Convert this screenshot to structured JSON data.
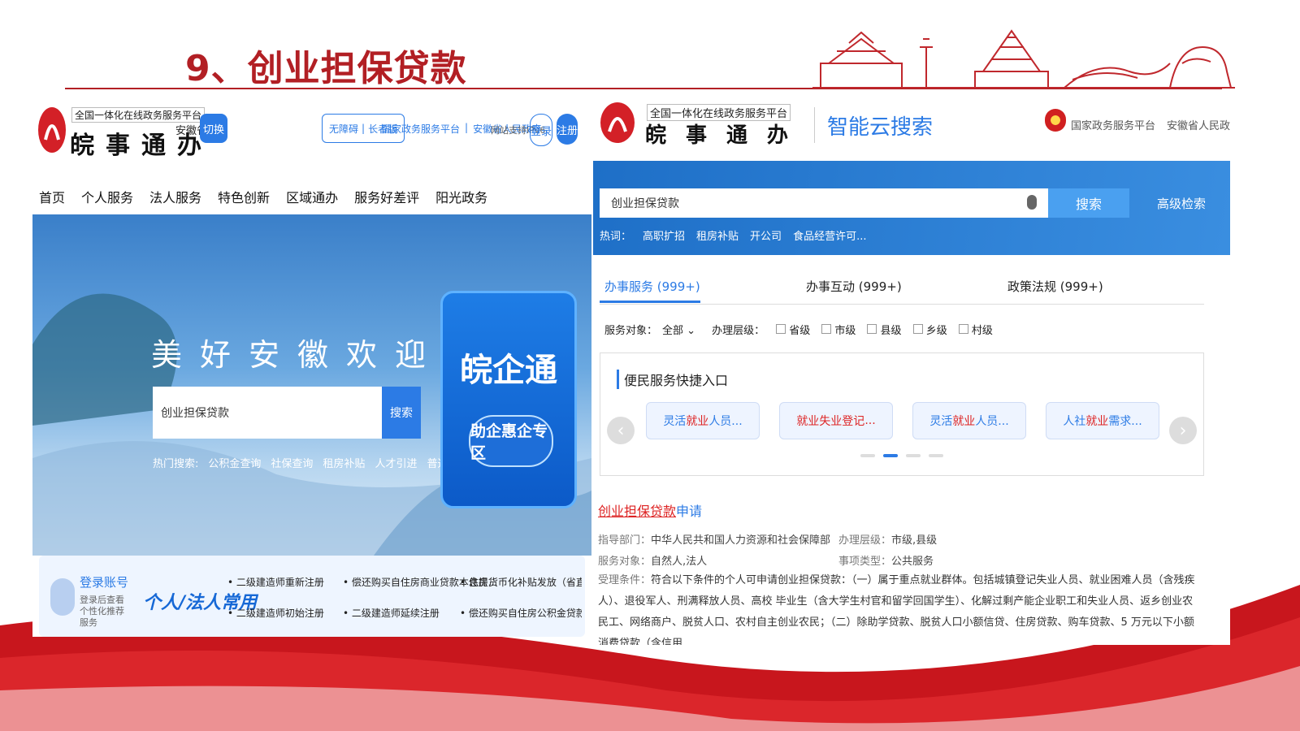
{
  "slide": {
    "title": "9、创业担保贷款"
  },
  "left": {
    "platform_label": "全国一体化在线政务服务平台",
    "brand": "皖事通办",
    "province": "安徽省",
    "switch_label": "切换",
    "access_links": [
      "无障碍",
      "长者版"
    ],
    "top_links": [
      "国家政务服务平台",
      "安徽省人民政府"
    ],
    "ipv6": "网站支持IPv6",
    "login": "登录",
    "register": "注册",
    "nav": [
      "首页",
      "个人服务",
      "法人服务",
      "特色创新",
      "区域通办",
      "服务好差评",
      "阳光政务"
    ],
    "welcome": "美好安徽欢迎您",
    "search_value": "创业担保贷款",
    "search_button": "搜索",
    "hot_label": "热门搜索:",
    "hot_items": [
      "公积金查询",
      "社保查询",
      "租房补贴",
      "人才引进",
      "普通话"
    ],
    "wqt_title": "皖企通",
    "wqt_button": "助企惠企专区",
    "login_account": "登录账号",
    "login_desc": "登录后查看个性化推荐服务",
    "common_label": "个人/法人常用",
    "quick_links": [
      "二级建造师重新注册",
      "偿还购买自住房商业贷款本息提...",
      "住房货币化补贴发放（省直驻肥...",
      "二级建造师初始注册",
      "二级建造师延续注册",
      "偿还购买自住房公积金贷款本息..."
    ]
  },
  "right": {
    "platform_label": "全国一体化在线政务服务平台",
    "brand": "皖事通办",
    "smart_search": "智能云搜索",
    "nat_links": [
      "国家政务服务平台",
      "安徽省人民政府"
    ],
    "search_value": "创业担保贷款",
    "search_button": "搜索",
    "advanced": "高级检索",
    "hot_label": "热词：",
    "hot_items": [
      "高职扩招",
      "租房补贴",
      "开公司",
      "食品经营许可..."
    ],
    "tabs": [
      "办事服务 (999+)",
      "办事互动 (999+)",
      "政策法规 (999+)"
    ],
    "filter_target_label": "服务对象：",
    "filter_target_value": "全部",
    "filter_level_label": "办理层级：",
    "filter_levels": [
      "省级",
      "市级",
      "县级",
      "乡级",
      "村级"
    ],
    "quick_title": "便民服务快捷入口",
    "quick_cards": [
      {
        "red": "",
        "blue": "灵活",
        "rest_red": "就业",
        "tail": "人员..."
      },
      {
        "red": "就业",
        "blue": "",
        "rest_red": "失业登记",
        "tail": "..."
      },
      {
        "red": "",
        "blue": "灵活",
        "rest_red": "就业",
        "tail": "人员..."
      },
      {
        "red": "",
        "blue": "人社",
        "rest_red": "就业",
        "tail": "需求..."
      }
    ],
    "result_title_hl": "创业担保贷款",
    "result_title_rest": "申请",
    "dept_label": "指导部门：",
    "dept_value": "中华人民共和国人力资源和社会保障部",
    "level_label": "办理层级：",
    "level_value": "市级,县级",
    "target_label": "服务对象：",
    "target_value": "自然人,法人",
    "type_label": "事项类型：",
    "type_value": "公共服务",
    "cond_label": "受理条件：",
    "cond_value": "符合以下条件的个人可申请创业担保贷款：（一）属于重点就业群体。包括城镇登记失业人员、就业困难人员（含残疾人）、退役军人、刑满释放人员、高校 毕业生（含大学生村官和留学回国学生）、化解过剩产能企业职工和失业人员、返乡创业农民工、网络商户、脱贫人口、农村自主创业农民；（二）除助学贷款、脱贫人口小额信贷、住房贷款、购车贷款、5 万元以下小额消费贷款（含信用..."
  },
  "colors": {
    "brand_red": "#b21f24",
    "accent_blue": "#2c7be5"
  }
}
